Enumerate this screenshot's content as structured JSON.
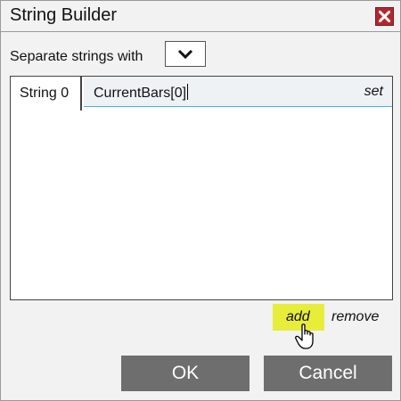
{
  "dialog": {
    "title": "String Builder",
    "close_icon": "close-icon"
  },
  "separator": {
    "label": "Separate strings with",
    "selected": ""
  },
  "strings": {
    "tabs": [
      {
        "label": "String 0"
      }
    ],
    "rows": [
      {
        "value": "CurrentBars[0]",
        "action": "set"
      }
    ]
  },
  "actions": {
    "add": "add",
    "remove": "remove"
  },
  "buttons": {
    "ok": "OK",
    "cancel": "Cancel"
  },
  "colors": {
    "close_bg": "#b3262b",
    "add_highlight": "#e8ec3b",
    "row_underline": "#4fb2d6",
    "button_bg": "#6e6e6e"
  }
}
